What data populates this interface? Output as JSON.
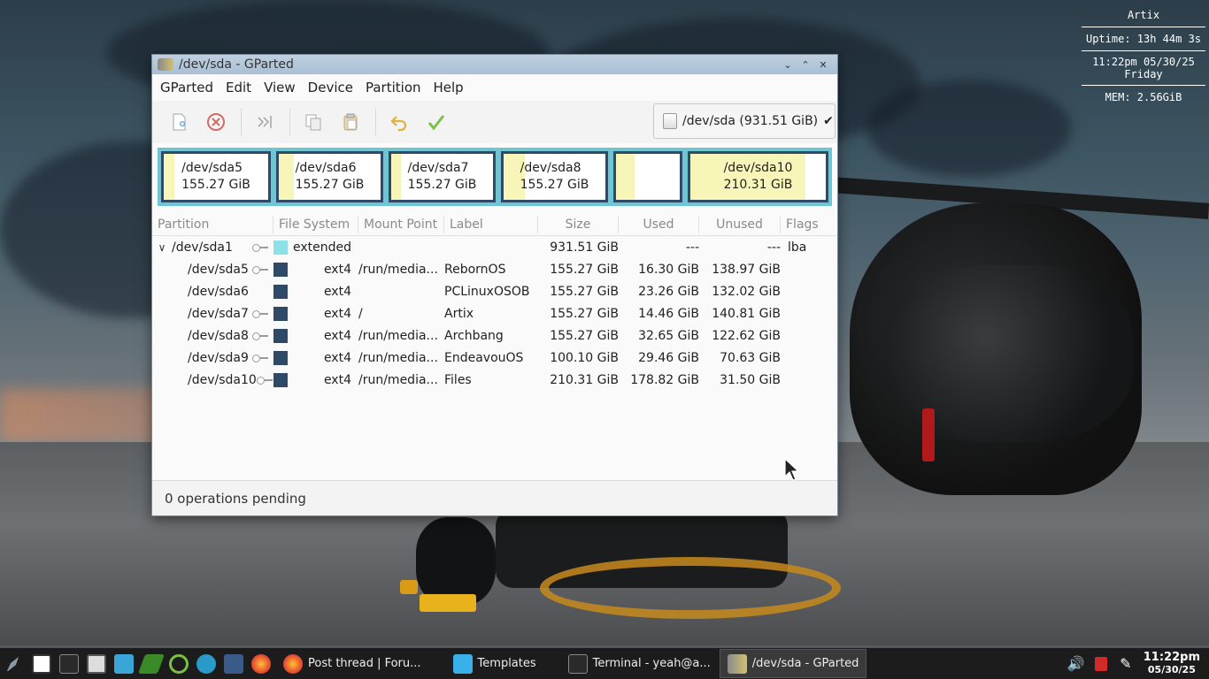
{
  "window": {
    "title": "/dev/sda - GParted",
    "menu": [
      "GParted",
      "Edit",
      "View",
      "Device",
      "Partition",
      "Help"
    ],
    "device_selector": "/dev/sda (931.51 GiB)",
    "status": "0 operations pending"
  },
  "toolbar": {
    "icons": [
      "new-partition-icon",
      "delete-partition-icon",
      "resize-move-icon",
      "copy-icon",
      "paste-icon",
      "undo-icon",
      "apply-icon"
    ]
  },
  "graph": [
    {
      "name": "/dev/sda5",
      "size": "155.27 GiB",
      "used_fraction": 0.105
    },
    {
      "name": "/dev/sda6",
      "size": "155.27 GiB",
      "used_fraction": 0.15
    },
    {
      "name": "/dev/sda7",
      "size": "155.27 GiB",
      "used_fraction": 0.093
    },
    {
      "name": "/dev/sda8",
      "size": "155.27 GiB",
      "used_fraction": 0.21
    },
    {
      "name": "",
      "size": "",
      "used_fraction": 0.294
    },
    {
      "name": "/dev/sda10",
      "size": "210.31 GiB",
      "used_fraction": 0.85
    }
  ],
  "table": {
    "headers": {
      "partition": "Partition",
      "filesystem": "File System",
      "mountpoint": "Mount Point",
      "label": "Label",
      "size": "Size",
      "used": "Used",
      "unused": "Unused",
      "flags": "Flags"
    },
    "rows": [
      {
        "partition": "/dev/sda1",
        "filesystem": "extended",
        "mountpoint": "",
        "label": "",
        "size": "931.51 GiB",
        "used": "---",
        "unused": "---",
        "flags": "lba"
      },
      {
        "partition": "/dev/sda5",
        "filesystem": "ext4",
        "mountpoint": "/run/media...",
        "label": "RebornOS",
        "size": "155.27 GiB",
        "used": "16.30 GiB",
        "unused": "138.97 GiB",
        "flags": ""
      },
      {
        "partition": "/dev/sda6",
        "filesystem": "ext4",
        "mountpoint": "",
        "label": "PCLinuxOSOB",
        "size": "155.27 GiB",
        "used": "23.26 GiB",
        "unused": "132.02 GiB",
        "flags": ""
      },
      {
        "partition": "/dev/sda7",
        "filesystem": "ext4",
        "mountpoint": "/",
        "label": "Artix",
        "size": "155.27 GiB",
        "used": "14.46 GiB",
        "unused": "140.81 GiB",
        "flags": ""
      },
      {
        "partition": "/dev/sda8",
        "filesystem": "ext4",
        "mountpoint": "/run/media...",
        "label": "Archbang",
        "size": "155.27 GiB",
        "used": "32.65 GiB",
        "unused": "122.62 GiB",
        "flags": ""
      },
      {
        "partition": "/dev/sda9",
        "filesystem": "ext4",
        "mountpoint": "/run/media...",
        "label": "EndeavouOS",
        "size": "100.10 GiB",
        "used": "29.46 GiB",
        "unused": "70.63 GiB",
        "flags": ""
      },
      {
        "partition": "/dev/sda10",
        "filesystem": "ext4",
        "mountpoint": "/run/media...",
        "label": "Files",
        "size": "210.31 GiB",
        "used": "178.82 GiB",
        "unused": "31.50 GiB",
        "flags": ""
      }
    ]
  },
  "conky": {
    "host": "Artix",
    "uptime": "Uptime: 13h 44m 3s",
    "datetime": "11:22pm 05/30/25",
    "day": "Friday",
    "mem": "MEM: 2.56GiB"
  },
  "taskbar": {
    "tasks": [
      {
        "label": "Post thread | Foru...",
        "icon": "firefox-icon",
        "active": false
      },
      {
        "label": "Templates",
        "icon": "folder-icon",
        "active": false
      },
      {
        "label": "Terminal - yeah@a...",
        "icon": "terminal-icon",
        "active": false
      },
      {
        "label": "/dev/sda - GParted",
        "icon": "gparted-icon",
        "active": true
      }
    ],
    "time": "11:22pm",
    "date": "05/30/25"
  },
  "colors": {
    "ext4": "#2e4a66",
    "extended": "#8ce0e8",
    "graph_border": "#6fc6d2",
    "used_fill": "#f8f5b8"
  }
}
